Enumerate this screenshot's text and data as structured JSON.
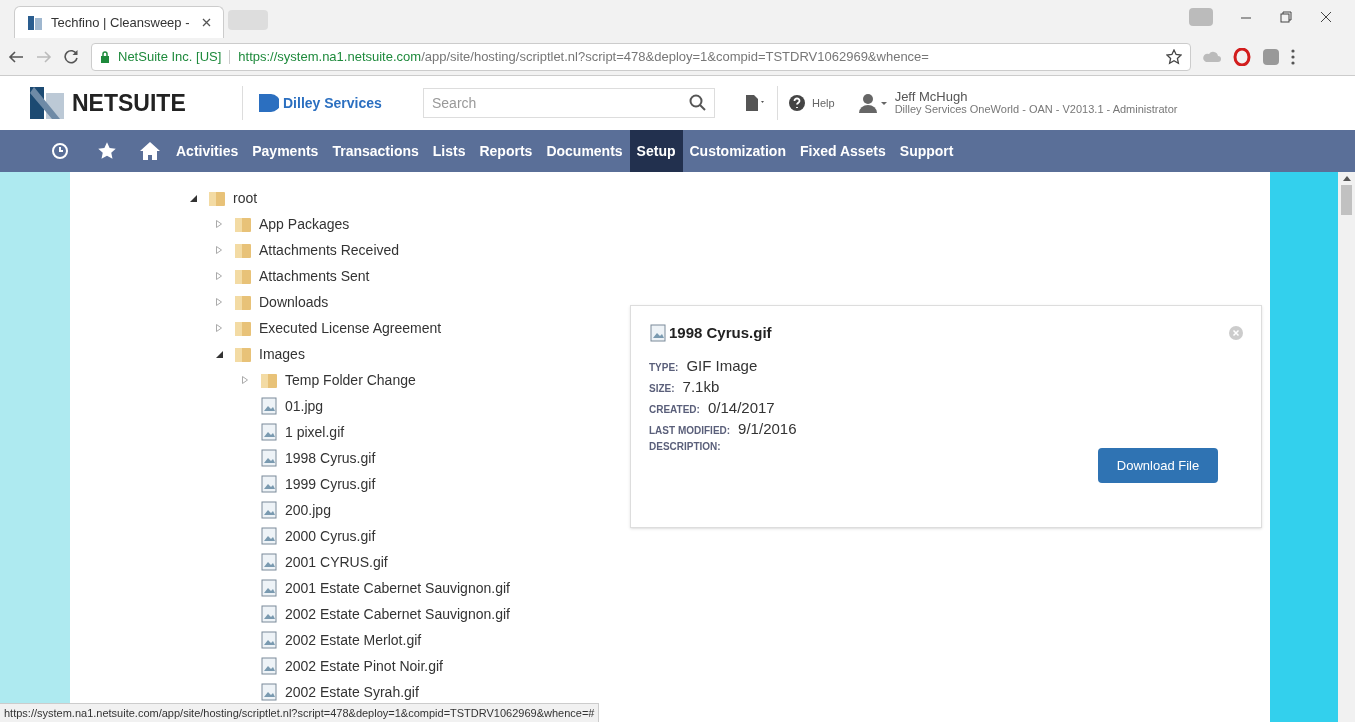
{
  "browser": {
    "tab_title": "Techfino | Cleansweep -",
    "site_identity": "NetSuite Inc. [US]",
    "url_host": "https://system.na1.netsuite.com",
    "url_path": "/app/site/hosting/scriptlet.nl?script=478&deploy=1&compid=TSTDRV1062969&whence="
  },
  "header": {
    "brand": "NETSUITE",
    "company": "Dilley Services",
    "search": {
      "placeholder": "Search"
    },
    "help": "Help",
    "user_name": "Jeff McHugh",
    "user_role": "Dilley Services OneWorld - OAN - V2013.1 - Administrator"
  },
  "nav": [
    {
      "label": "Activities",
      "selected": false
    },
    {
      "label": "Payments",
      "selected": false
    },
    {
      "label": "Transactions",
      "selected": false
    },
    {
      "label": "Lists",
      "selected": false
    },
    {
      "label": "Reports",
      "selected": false
    },
    {
      "label": "Documents",
      "selected": false
    },
    {
      "label": "Setup",
      "selected": true
    },
    {
      "label": "Customization",
      "selected": false
    },
    {
      "label": "Fixed Assets",
      "selected": false
    },
    {
      "label": "Support",
      "selected": false
    }
  ],
  "tree": [
    {
      "kind": "folder",
      "label": "root",
      "expanded": true,
      "children": [
        {
          "kind": "folder",
          "label": "App Packages",
          "expanded": false
        },
        {
          "kind": "folder",
          "label": "Attachments Received",
          "expanded": false
        },
        {
          "kind": "folder",
          "label": "Attachments Sent",
          "expanded": false
        },
        {
          "kind": "folder",
          "label": "Downloads",
          "expanded": false
        },
        {
          "kind": "folder",
          "label": "Executed License Agreement",
          "expanded": false
        },
        {
          "kind": "folder",
          "label": "Images",
          "expanded": true,
          "children": [
            {
              "kind": "folder",
              "label": "Temp Folder Change",
              "expanded": false
            },
            {
              "kind": "file",
              "label": "01.jpg"
            },
            {
              "kind": "file",
              "label": "1 pixel.gif"
            },
            {
              "kind": "file",
              "label": "1998 Cyrus.gif"
            },
            {
              "kind": "file",
              "label": "1999 Cyrus.gif"
            },
            {
              "kind": "file",
              "label": "200.jpg"
            },
            {
              "kind": "file",
              "label": "2000 Cyrus.gif"
            },
            {
              "kind": "file",
              "label": "2001 CYRUS.gif"
            },
            {
              "kind": "file",
              "label": "2001 Estate Cabernet Sauvignon.gif"
            },
            {
              "kind": "file",
              "label": "2002 Estate Cabernet Sauvignon.gif"
            },
            {
              "kind": "file",
              "label": "2002 Estate Merlot.gif"
            },
            {
              "kind": "file",
              "label": "2002 Estate Pinot Noir.gif"
            },
            {
              "kind": "file",
              "label": "2002 Estate Syrah.gif"
            }
          ]
        }
      ]
    }
  ],
  "file_card": {
    "title": "1998 Cyrus.gif",
    "fields": [
      {
        "label": "TYPE:",
        "value": "GIF Image"
      },
      {
        "label": "SIZE:",
        "value": "7.1kb"
      },
      {
        "label": "CREATED:",
        "value": "0/14/2017"
      },
      {
        "label": "LAST MODIFIED:",
        "value": "9/1/2016"
      },
      {
        "label": "DESCRIPTION:"
      }
    ],
    "button": "Download File"
  },
  "status_bar": "https://system.na1.netsuite.com/app/site/hosting/scriptlet.nl?script=478&deploy=1&compid=TSTDRV1062969&whence=#"
}
